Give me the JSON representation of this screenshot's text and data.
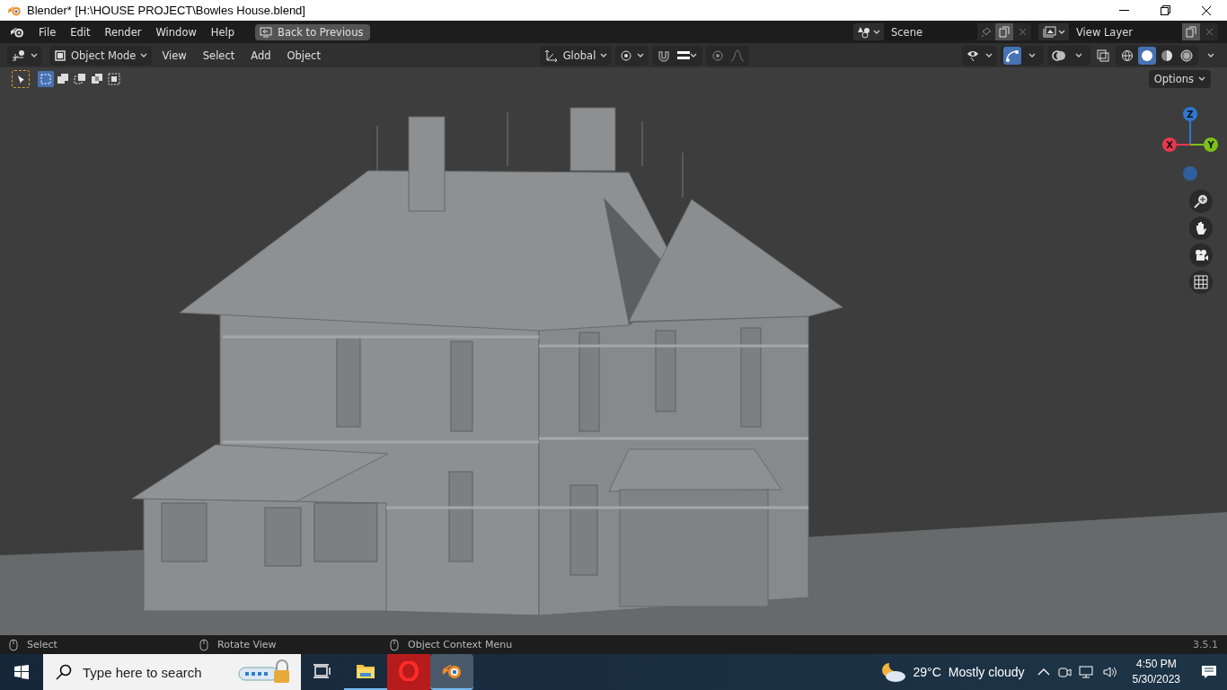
{
  "window": {
    "title": "Blender* [H:\\HOUSE PROJECT\\Bowles House.blend]"
  },
  "menu_bar": {
    "menus": [
      "File",
      "Edit",
      "Render",
      "Window",
      "Help"
    ],
    "back_button": "Back to Previous",
    "scene": "Scene",
    "view_layer": "View Layer"
  },
  "header": {
    "mode": "Object Mode",
    "menus": [
      "View",
      "Select",
      "Add",
      "Object"
    ],
    "orientation": "Global",
    "show_gizmos": true,
    "shading": [
      {
        "kind": "wireframe",
        "selected": false
      },
      {
        "kind": "solid",
        "selected": true
      },
      {
        "kind": "material",
        "selected": false
      },
      {
        "kind": "rendered",
        "selected": false
      }
    ]
  },
  "tool_settings": {
    "select_modes": [
      {
        "kind": "set",
        "selected": true
      },
      {
        "kind": "extend",
        "selected": false
      },
      {
        "kind": "subtract",
        "selected": false
      },
      {
        "kind": "invert",
        "selected": false
      },
      {
        "kind": "intersect",
        "selected": false
      }
    ],
    "options": "Options"
  },
  "navigation_gizmo": {
    "axes": [
      {
        "label": "Z",
        "color": "#2f77d0"
      },
      {
        "label": "X",
        "color": "#e8384f"
      },
      {
        "label": "Y",
        "color": "#7ec01a"
      }
    ]
  },
  "status_bar": {
    "hints": [
      "Select",
      "Rotate View",
      "Object Context Menu"
    ],
    "version": "3.5.1"
  },
  "taskbar": {
    "search_placeholder": "Type here to search",
    "apps": [
      {
        "kind": "task-view",
        "running": false,
        "selected": false
      },
      {
        "kind": "file-explorer",
        "running": true,
        "selected": false
      },
      {
        "kind": "opera",
        "running": false,
        "selected": false
      },
      {
        "kind": "blender",
        "running": true,
        "selected": true
      }
    ],
    "weather": {
      "temperature": "29°C",
      "condition": "Mostly cloudy"
    },
    "time": "4:50 PM",
    "date": "5/30/2023"
  }
}
